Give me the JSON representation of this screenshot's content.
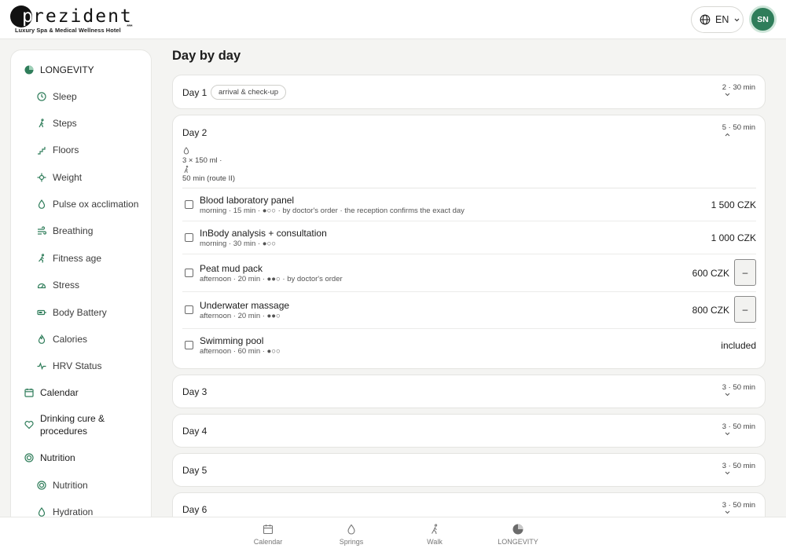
{
  "brand": {
    "logo_letter": "p",
    "logo_word": "rezident",
    "tagline": "Luxury Spa & Medical Wellness Hotel",
    "stars": "****"
  },
  "header": {
    "language": "EN",
    "user_initials": "SN"
  },
  "sidebar": {
    "longevity": "LONGEVITY",
    "longevity_items": [
      {
        "label": "Sleep",
        "icon": "clock-icon"
      },
      {
        "label": "Steps",
        "icon": "walker-icon"
      },
      {
        "label": "Floors",
        "icon": "stairs-icon"
      },
      {
        "label": "Weight",
        "icon": "weight-icon"
      },
      {
        "label": "Pulse ox acclimation",
        "icon": "drop-icon"
      },
      {
        "label": "Breathing",
        "icon": "wind-icon"
      },
      {
        "label": "Fitness age",
        "icon": "runner-icon"
      },
      {
        "label": "Stress",
        "icon": "gauge-icon"
      },
      {
        "label": "Body Battery",
        "icon": "battery-icon"
      },
      {
        "label": "Calories",
        "icon": "flame-icon"
      },
      {
        "label": "HRV Status",
        "icon": "pulse-icon"
      }
    ],
    "calendar": "Calendar",
    "drinking_cure": "Drinking cure & procedures",
    "nutrition": "Nutrition",
    "nutrition_items": [
      {
        "label": "Nutrition",
        "icon": "target-icon"
      },
      {
        "label": "Hydration",
        "icon": "drop-icon"
      }
    ]
  },
  "main": {
    "title": "Day by day",
    "days": [
      {
        "name": "Day 1",
        "badge": "arrival & check-up",
        "meta": "2 · 30 min"
      },
      {
        "name": "Day 2",
        "meta": "5 · 50 min",
        "drinking": "3 × 150 ml ·",
        "walk": "50 min (route II)",
        "procedures": [
          {
            "name": "Blood laboratory panel",
            "meta": "morning · 15 min · ●○○ · by doctor's order · the reception confirms the exact day",
            "price": "1 500 CZK",
            "removable": false
          },
          {
            "name": "InBody analysis + consultation",
            "meta": "morning · 30 min · ●○○",
            "price": "1 000 CZK",
            "removable": false
          },
          {
            "name": "Peat mud pack",
            "meta": "afternoon · 20 min · ●●○ · by doctor's order",
            "price": "600 CZK",
            "removable": true
          },
          {
            "name": "Underwater massage",
            "meta": "afternoon · 20 min · ●●○",
            "price": "800 CZK",
            "removable": true
          },
          {
            "name": "Swimming pool",
            "meta": "afternoon · 60 min · ●○○",
            "price": "included",
            "removable": false
          }
        ]
      },
      {
        "name": "Day 3",
        "meta": "3 · 50 min"
      },
      {
        "name": "Day 4",
        "meta": "3 · 50 min"
      },
      {
        "name": "Day 5",
        "meta": "3 · 50 min"
      },
      {
        "name": "Day 6",
        "meta": "3 · 50 min"
      }
    ],
    "remove_label": "–"
  },
  "bottom_nav": [
    {
      "label": "Calendar",
      "icon": "calendar-icon"
    },
    {
      "label": "Springs",
      "icon": "drop-icon"
    },
    {
      "label": "Walk",
      "icon": "walker-icon"
    },
    {
      "label": "LONGEVITY",
      "icon": "longevity-icon"
    }
  ],
  "colors": {
    "accent": "#2f7d5a",
    "background": "#f4f4f2"
  }
}
